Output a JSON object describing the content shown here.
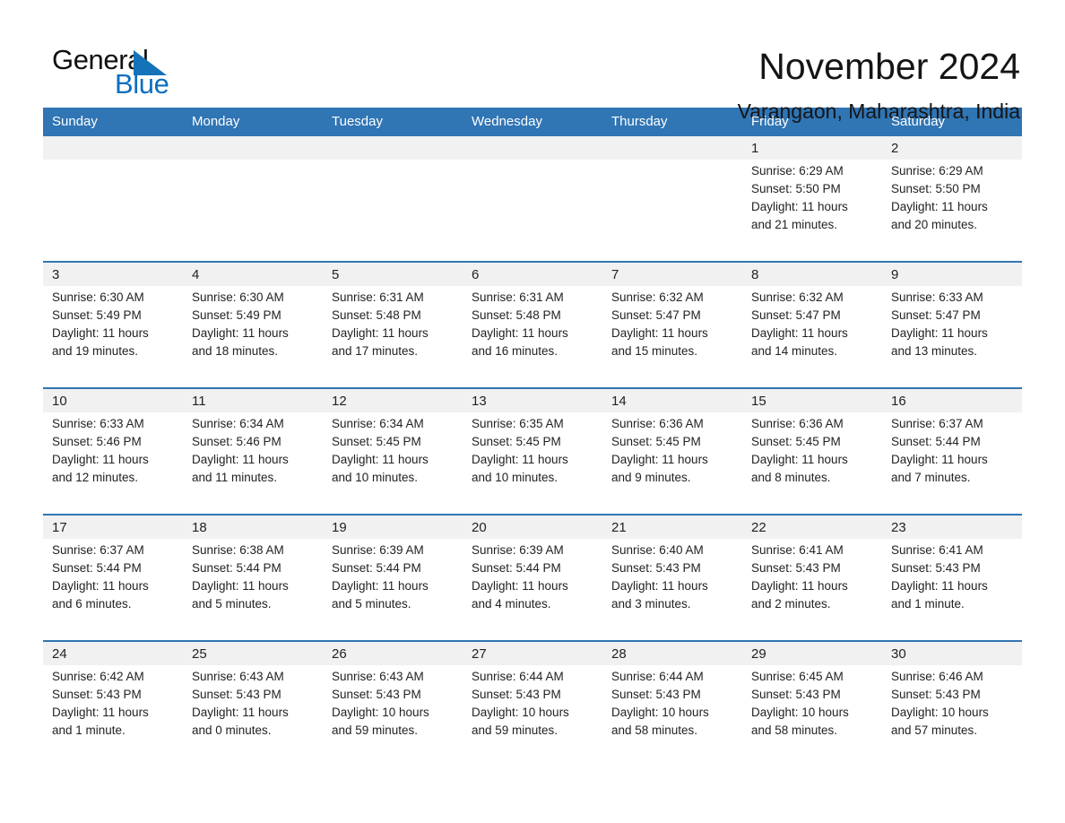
{
  "brand": {
    "name_part1": "General",
    "name_part2": "Blue",
    "triangle_color": "#1472b8",
    "blue_color": "#0d6ebf"
  },
  "header": {
    "title": "November 2024",
    "subtitle": "Varangaon, Maharashtra, India"
  },
  "theme": {
    "header_blue": "#3075b4",
    "daynum_bg": "#f1f1f1",
    "text": "#222222"
  },
  "weekdays": [
    "Sunday",
    "Monday",
    "Tuesday",
    "Wednesday",
    "Thursday",
    "Friday",
    "Saturday"
  ],
  "weeks": [
    {
      "days": [
        {
          "num": "",
          "sunrise": "",
          "sunset": "",
          "daylight1": "",
          "daylight2": ""
        },
        {
          "num": "",
          "sunrise": "",
          "sunset": "",
          "daylight1": "",
          "daylight2": ""
        },
        {
          "num": "",
          "sunrise": "",
          "sunset": "",
          "daylight1": "",
          "daylight2": ""
        },
        {
          "num": "",
          "sunrise": "",
          "sunset": "",
          "daylight1": "",
          "daylight2": ""
        },
        {
          "num": "",
          "sunrise": "",
          "sunset": "",
          "daylight1": "",
          "daylight2": ""
        },
        {
          "num": "1",
          "sunrise": "Sunrise: 6:29 AM",
          "sunset": "Sunset: 5:50 PM",
          "daylight1": "Daylight: 11 hours",
          "daylight2": "and 21 minutes."
        },
        {
          "num": "2",
          "sunrise": "Sunrise: 6:29 AM",
          "sunset": "Sunset: 5:50 PM",
          "daylight1": "Daylight: 11 hours",
          "daylight2": "and 20 minutes."
        }
      ]
    },
    {
      "days": [
        {
          "num": "3",
          "sunrise": "Sunrise: 6:30 AM",
          "sunset": "Sunset: 5:49 PM",
          "daylight1": "Daylight: 11 hours",
          "daylight2": "and 19 minutes."
        },
        {
          "num": "4",
          "sunrise": "Sunrise: 6:30 AM",
          "sunset": "Sunset: 5:49 PM",
          "daylight1": "Daylight: 11 hours",
          "daylight2": "and 18 minutes."
        },
        {
          "num": "5",
          "sunrise": "Sunrise: 6:31 AM",
          "sunset": "Sunset: 5:48 PM",
          "daylight1": "Daylight: 11 hours",
          "daylight2": "and 17 minutes."
        },
        {
          "num": "6",
          "sunrise": "Sunrise: 6:31 AM",
          "sunset": "Sunset: 5:48 PM",
          "daylight1": "Daylight: 11 hours",
          "daylight2": "and 16 minutes."
        },
        {
          "num": "7",
          "sunrise": "Sunrise: 6:32 AM",
          "sunset": "Sunset: 5:47 PM",
          "daylight1": "Daylight: 11 hours",
          "daylight2": "and 15 minutes."
        },
        {
          "num": "8",
          "sunrise": "Sunrise: 6:32 AM",
          "sunset": "Sunset: 5:47 PM",
          "daylight1": "Daylight: 11 hours",
          "daylight2": "and 14 minutes."
        },
        {
          "num": "9",
          "sunrise": "Sunrise: 6:33 AM",
          "sunset": "Sunset: 5:47 PM",
          "daylight1": "Daylight: 11 hours",
          "daylight2": "and 13 minutes."
        }
      ]
    },
    {
      "days": [
        {
          "num": "10",
          "sunrise": "Sunrise: 6:33 AM",
          "sunset": "Sunset: 5:46 PM",
          "daylight1": "Daylight: 11 hours",
          "daylight2": "and 12 minutes."
        },
        {
          "num": "11",
          "sunrise": "Sunrise: 6:34 AM",
          "sunset": "Sunset: 5:46 PM",
          "daylight1": "Daylight: 11 hours",
          "daylight2": "and 11 minutes."
        },
        {
          "num": "12",
          "sunrise": "Sunrise: 6:34 AM",
          "sunset": "Sunset: 5:45 PM",
          "daylight1": "Daylight: 11 hours",
          "daylight2": "and 10 minutes."
        },
        {
          "num": "13",
          "sunrise": "Sunrise: 6:35 AM",
          "sunset": "Sunset: 5:45 PM",
          "daylight1": "Daylight: 11 hours",
          "daylight2": "and 10 minutes."
        },
        {
          "num": "14",
          "sunrise": "Sunrise: 6:36 AM",
          "sunset": "Sunset: 5:45 PM",
          "daylight1": "Daylight: 11 hours",
          "daylight2": "and 9 minutes."
        },
        {
          "num": "15",
          "sunrise": "Sunrise: 6:36 AM",
          "sunset": "Sunset: 5:45 PM",
          "daylight1": "Daylight: 11 hours",
          "daylight2": "and 8 minutes."
        },
        {
          "num": "16",
          "sunrise": "Sunrise: 6:37 AM",
          "sunset": "Sunset: 5:44 PM",
          "daylight1": "Daylight: 11 hours",
          "daylight2": "and 7 minutes."
        }
      ]
    },
    {
      "days": [
        {
          "num": "17",
          "sunrise": "Sunrise: 6:37 AM",
          "sunset": "Sunset: 5:44 PM",
          "daylight1": "Daylight: 11 hours",
          "daylight2": "and 6 minutes."
        },
        {
          "num": "18",
          "sunrise": "Sunrise: 6:38 AM",
          "sunset": "Sunset: 5:44 PM",
          "daylight1": "Daylight: 11 hours",
          "daylight2": "and 5 minutes."
        },
        {
          "num": "19",
          "sunrise": "Sunrise: 6:39 AM",
          "sunset": "Sunset: 5:44 PM",
          "daylight1": "Daylight: 11 hours",
          "daylight2": "and 5 minutes."
        },
        {
          "num": "20",
          "sunrise": "Sunrise: 6:39 AM",
          "sunset": "Sunset: 5:44 PM",
          "daylight1": "Daylight: 11 hours",
          "daylight2": "and 4 minutes."
        },
        {
          "num": "21",
          "sunrise": "Sunrise: 6:40 AM",
          "sunset": "Sunset: 5:43 PM",
          "daylight1": "Daylight: 11 hours",
          "daylight2": "and 3 minutes."
        },
        {
          "num": "22",
          "sunrise": "Sunrise: 6:41 AM",
          "sunset": "Sunset: 5:43 PM",
          "daylight1": "Daylight: 11 hours",
          "daylight2": "and 2 minutes."
        },
        {
          "num": "23",
          "sunrise": "Sunrise: 6:41 AM",
          "sunset": "Sunset: 5:43 PM",
          "daylight1": "Daylight: 11 hours",
          "daylight2": "and 1 minute."
        }
      ]
    },
    {
      "days": [
        {
          "num": "24",
          "sunrise": "Sunrise: 6:42 AM",
          "sunset": "Sunset: 5:43 PM",
          "daylight1": "Daylight: 11 hours",
          "daylight2": "and 1 minute."
        },
        {
          "num": "25",
          "sunrise": "Sunrise: 6:43 AM",
          "sunset": "Sunset: 5:43 PM",
          "daylight1": "Daylight: 11 hours",
          "daylight2": "and 0 minutes."
        },
        {
          "num": "26",
          "sunrise": "Sunrise: 6:43 AM",
          "sunset": "Sunset: 5:43 PM",
          "daylight1": "Daylight: 10 hours",
          "daylight2": "and 59 minutes."
        },
        {
          "num": "27",
          "sunrise": "Sunrise: 6:44 AM",
          "sunset": "Sunset: 5:43 PM",
          "daylight1": "Daylight: 10 hours",
          "daylight2": "and 59 minutes."
        },
        {
          "num": "28",
          "sunrise": "Sunrise: 6:44 AM",
          "sunset": "Sunset: 5:43 PM",
          "daylight1": "Daylight: 10 hours",
          "daylight2": "and 58 minutes."
        },
        {
          "num": "29",
          "sunrise": "Sunrise: 6:45 AM",
          "sunset": "Sunset: 5:43 PM",
          "daylight1": "Daylight: 10 hours",
          "daylight2": "and 58 minutes."
        },
        {
          "num": "30",
          "sunrise": "Sunrise: 6:46 AM",
          "sunset": "Sunset: 5:43 PM",
          "daylight1": "Daylight: 10 hours",
          "daylight2": "and 57 minutes."
        }
      ]
    }
  ]
}
